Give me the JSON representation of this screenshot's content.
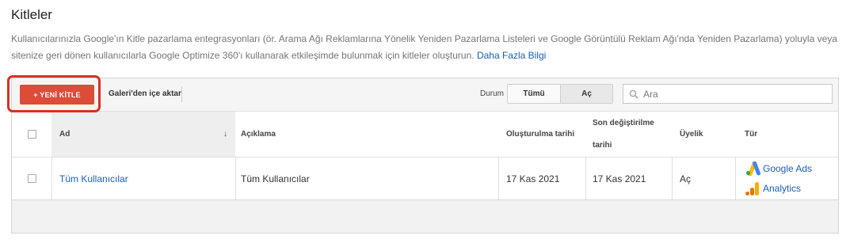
{
  "page": {
    "title": "Kitleler",
    "description": "Kullanıcılarınızla Google'ın Kitle pazarlama entegrasyonları (ör. Arama Ağı Reklamlarına Yönelik Yeniden Pazarlama Listeleri ve Google Görüntülü Reklam Ağı'nda Yeniden Pazarlama) yoluyla veya sitenize geri dönen kullanıcılarla Google Optimize 360'ı kullanarak etkileşimde bulunmak için kitleler oluşturun.",
    "learn_more": "Daha Fazla Bilgi"
  },
  "toolbar": {
    "new_audience": "+ YENİ KİTLE",
    "import_gallery": "Galeri'den içe aktar",
    "status_label": "Durum",
    "filter_all": "Tümü",
    "filter_open": "Aç",
    "search_placeholder": "Ara"
  },
  "table": {
    "headers": {
      "name": "Ad",
      "sort_indicator": "↓",
      "description": "Açıklama",
      "created": "Oluşturulma tarihi",
      "modified_line1": "Son değiştirilme",
      "modified_line2": "tarihi",
      "membership": "Üyelik",
      "type": "Tür"
    },
    "rows": [
      {
        "name": "Tüm Kullanıcılar",
        "description": "Tüm Kullanıcılar",
        "created": "17 Kas 2021",
        "modified": "17 Kas 2021",
        "membership": "Aç",
        "types": [
          {
            "label": "Google Ads",
            "icon": "google-ads-icon"
          },
          {
            "label": "Analytics",
            "icon": "analytics-icon"
          }
        ]
      }
    ]
  },
  "colors": {
    "primary_button": "#dd4b39",
    "highlight_outline": "#d93025",
    "link": "#1a5fb4"
  }
}
